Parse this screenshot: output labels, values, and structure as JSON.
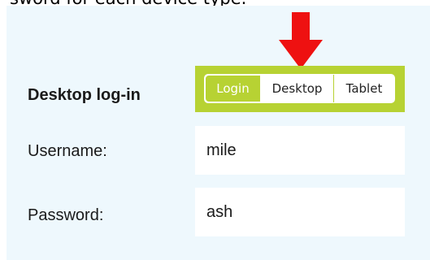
{
  "intro": {
    "text": "sword for each device type."
  },
  "tabs": [
    {
      "label": "Login",
      "active": true
    },
    {
      "label": "Desktop",
      "active": false
    },
    {
      "label": "Tablet",
      "active": false
    }
  ],
  "section": {
    "title": "Desktop log-in"
  },
  "fields": {
    "username": {
      "label": "Username:",
      "value": "mile"
    },
    "password": {
      "label": "Password:",
      "value": "ash"
    }
  },
  "colors": {
    "panel_background": "#eef8fd",
    "accent_green": "#b7d233",
    "arrow_red": "#ee1111"
  },
  "icons": {
    "pointer": "down-arrow-icon"
  }
}
